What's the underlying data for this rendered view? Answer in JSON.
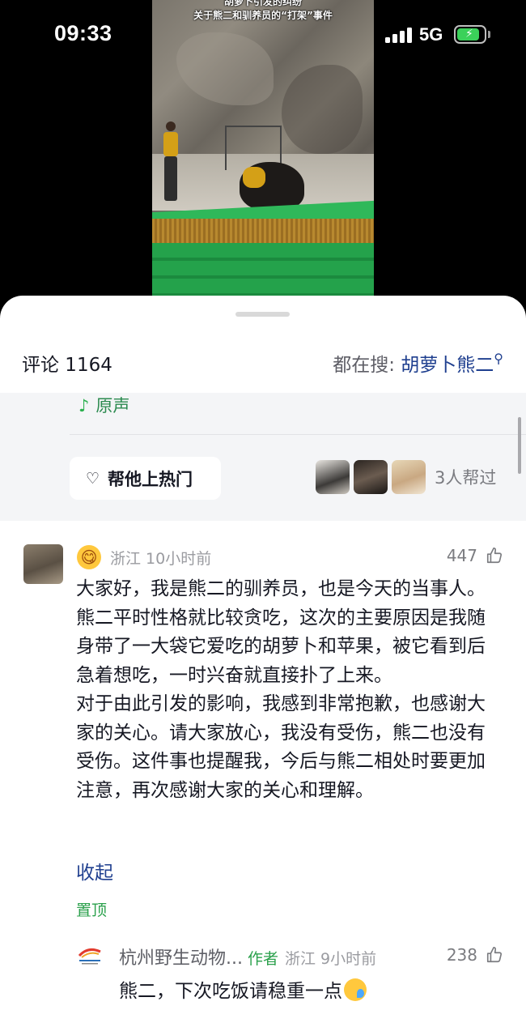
{
  "status_bar": {
    "time": "09:33",
    "network": "5G",
    "battery_level": 0.85,
    "battery_color": "#3bd15a"
  },
  "video": {
    "overlay_title": "胡萝卜引发的纠纷\n关于熊二和驯养员的“打架”事件"
  },
  "sheet": {
    "comments_label": "评论 1164",
    "search_prefix": "都在搜:",
    "search_term": "胡萝卜熊二",
    "search_icon": "search-icon"
  },
  "panel": {
    "music_label": "原声",
    "boost_button": "帮他上热门",
    "helpers_text": "3人帮过"
  },
  "comment": {
    "location_time": "浙江 10小时前",
    "likes": "447",
    "text": "大家好，我是熊二的驯养员，也是今天的当事人。熊二平时性格就比较贪吃，这次的主要原因是我随身带了一大袋它爱吃的胡萝卜和苹果，被它看到后急着想吃，一时兴奋就直接扑了上来。\n对于由此引发的影响，我感到非常抱歉，也感谢大家的关心。请大家放心，我没有受伤，熊二也没有受伤。这件事也提醒我，今后与熊二相处时要更加注意，再次感谢大家的关心和理解。",
    "collapse": "收起",
    "pinned": "置顶"
  },
  "reply": {
    "author": "杭州野生动物...",
    "author_tag": "作者",
    "location_time": "浙江 9小时前",
    "likes": "238",
    "text": "熊二，下次吃饭请稳重一点"
  },
  "colors": {
    "accent_link": "#1f3f8f",
    "accent_green": "#2aa04b"
  }
}
